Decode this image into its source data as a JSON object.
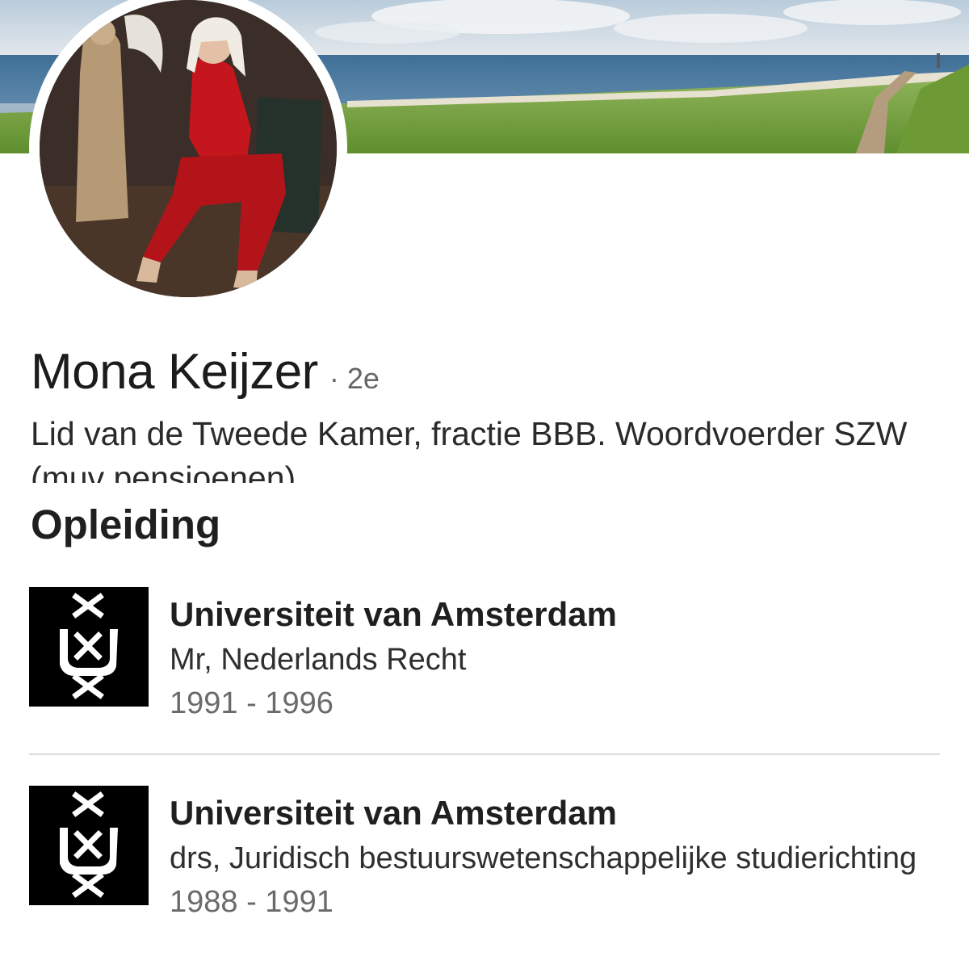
{
  "profile": {
    "name": "Mona Keijzer",
    "connection_degree": "· 2e",
    "headline": "Lid van de Tweede Kamer, fractie BBB. Woordvoerder SZW (muv pensioenen)"
  },
  "education": {
    "title": "Opleiding",
    "items": [
      {
        "school": "Universiteit van Amsterdam",
        "degree": "Mr, Nederlands Recht",
        "years": "1991 - 1996"
      },
      {
        "school": "Universiteit van Amsterdam",
        "degree": "drs, Juridisch bestuurswetenschappelijke studierichting",
        "years": "1988 - 1991"
      }
    ]
  },
  "colors": {
    "logo_background": "#000000",
    "text_primary": "#1f1f1f",
    "text_secondary": "#6a6a6a"
  }
}
